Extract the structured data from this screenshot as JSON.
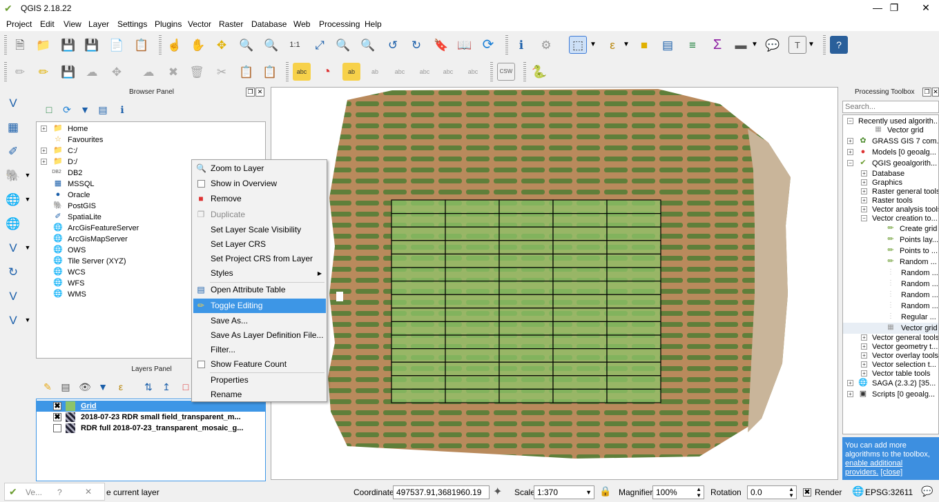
{
  "window": {
    "title": "QGIS 2.18.22",
    "minimize": "—",
    "maximize": "❐",
    "close": "✕"
  },
  "menubar": [
    "Project",
    "Edit",
    "View",
    "Layer",
    "Settings",
    "Plugins",
    "Vector",
    "Raster",
    "Database",
    "Web",
    "Processing",
    "Help"
  ],
  "browser_panel": {
    "title": "Browser Panel",
    "items": [
      "Home",
      "Favourites",
      "C:/",
      "D:/",
      "DB2",
      "MSSQL",
      "Oracle",
      "PostGIS",
      "SpatiaLite",
      "ArcGisFeatureServer",
      "ArcGisMapServer",
      "OWS",
      "Tile Server (XYZ)",
      "WCS",
      "WFS",
      "WMS"
    ]
  },
  "layers_panel": {
    "title": "Layers Panel",
    "layers": [
      "Grid",
      "2018-07-23 RDR small field_transparent_m...",
      "RDR full 2018-07-23_transparent_mosaic_g..."
    ]
  },
  "context_menu": {
    "items": [
      "Zoom to Layer",
      "Show in Overview",
      "Remove",
      "Duplicate",
      "Set Layer Scale Visibility",
      "Set Layer CRS",
      "Set Project CRS from Layer",
      "Styles",
      "Open Attribute Table",
      "Toggle Editing",
      "Save As...",
      "Save As Layer Definition File...",
      "Filter...",
      "Show Feature Count",
      "Properties",
      "Rename"
    ],
    "submenu_arrow": "▶"
  },
  "processing_toolbox": {
    "title": "Processing Toolbox",
    "search_placeholder": "Search...",
    "items": [
      "Recently used algorith...",
      "Vector grid",
      "GRASS GIS 7 com...",
      "Models [0 geoalg...",
      "QGIS geoalgorith...",
      "Database",
      "Graphics",
      "Raster general tools",
      "Raster tools",
      "Vector analysis tools",
      "Vector creation to...",
      "Create grid",
      "Points lay...",
      "Points to ...",
      "Random ...",
      "Random ...",
      "Random ...",
      "Random ...",
      "Random ...",
      "Regular ...",
      "Vector grid",
      "Vector general tools",
      "Vector geometry t...",
      "Vector overlay tools",
      "Vector selection t...",
      "Vector table tools",
      "SAGA (2.3.2) [35...",
      "Scripts [0 geoalg..."
    ],
    "info_text": "You can add more algorithms to the toolbox,",
    "info_link1": "enable additional providers.",
    "info_link2": "[close]"
  },
  "statusbar": {
    "task_label": "Ve...",
    "task_help": "?",
    "task_close": "✕",
    "message": "e current layer",
    "coordinate_label": "Coordinate",
    "coordinate_value": "497537.91,3681960.19",
    "scale_label": "Scale",
    "scale_value": "1:370",
    "magnifier_label": "Magnifier",
    "magnifier_value": "100%",
    "rotation_label": "Rotation",
    "rotation_value": "0.0",
    "render_label": "Render",
    "crs": "EPSG:32611"
  },
  "map": {
    "grid_rows": 15,
    "grid_cols": 5,
    "field_color": "#b98a5c",
    "grid_fill": "#8dc46a"
  },
  "colors": {
    "accent": "#3d96e6",
    "link": "#0000ee",
    "info_bg": "#3d8fe0"
  }
}
